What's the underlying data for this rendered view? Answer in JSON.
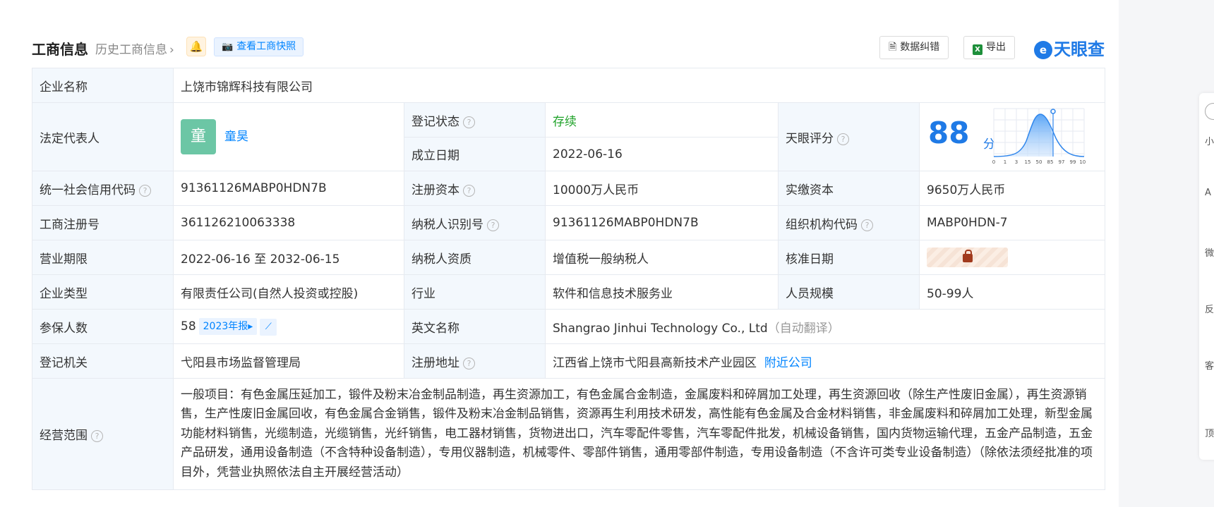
{
  "header": {
    "title": "工商信息",
    "history_link": "历史工商信息",
    "snapshot_btn": "查看工商快照",
    "correction_btn": "数据纠错",
    "export_btn": "导出",
    "logo_text": "天眼查"
  },
  "company": {
    "name_label": "企业名称",
    "name": "上饶市锦辉科技有限公司",
    "legal_label": "法定代表人",
    "legal_avatar": "童",
    "legal_name": "童昊",
    "reg_status_label": "登记状态",
    "reg_status": "存续",
    "found_date_label": "成立日期",
    "found_date": "2022-06-16",
    "score_label": "天眼评分",
    "score_value": "88",
    "score_unit": "分",
    "score_ticks": [
      "0",
      "1",
      "3",
      "15",
      "50",
      "85",
      "97",
      "99",
      "100"
    ],
    "credit_code_label": "统一社会信用代码",
    "credit_code": "91361126MABP0HDN7B",
    "reg_capital_label": "注册资本",
    "reg_capital": "10000万人民币",
    "paid_capital_label": "实缴资本",
    "paid_capital": "9650万人民币",
    "biz_reg_no_label": "工商注册号",
    "biz_reg_no": "361126210063338",
    "taxpayer_id_label": "纳税人识别号",
    "taxpayer_id": "91361126MABP0HDN7B",
    "org_code_label": "组织机构代码",
    "org_code": "MABP0HDN-7",
    "term_label": "营业期限",
    "term": "2022-06-16 至 2032-06-15",
    "tax_qual_label": "纳税人资质",
    "tax_qual": "增值税一般纳税人",
    "approve_date_label": "核准日期",
    "type_label": "企业类型",
    "type": "有限责任公司(自然人投资或控股)",
    "industry_label": "行业",
    "industry": "软件和信息技术服务业",
    "staff_label": "人员规模",
    "staff": "50-99人",
    "insured_label": "参保人数",
    "insured": "58",
    "insured_report": "2023年报",
    "en_name_label": "英文名称",
    "en_name": "Shangrao Jinhui Technology Co., Ltd",
    "en_name_note": "（自动翻译）",
    "authority_label": "登记机关",
    "authority": "弋阳县市场监督管理局",
    "address_label": "注册地址",
    "address": "江西省上饶市弋阳县高新技术产业园区",
    "nearby_link": "附近公司",
    "scope_label": "经营范围",
    "scope": "一般项目：有色金属压延加工，锻件及粉末冶金制品制造，再生资源加工，有色金属合金制造，金属废料和碎屑加工处理，再生资源回收（除生产性废旧金属），再生资源销售，生产性废旧金属回收，有色金属合金销售，锻件及粉末冶金制品销售，资源再生利用技术研发，高性能有色金属及合金材料销售，非金属废料和碎屑加工处理，新型金属功能材料销售，光缆制造，光缆销售，光纤销售，电工器材销售，货物进出口，汽车零配件零售，汽车零配件批发，机械设备销售，国内货物运输代理，五金产品制造，五金产品研发，通用设备制造（不含特种设备制造），专用仪器制造，机械零件、零部件销售，通用零部件制造，专用设备制造（不含许可类专业设备制造）（除依法须经批准的项目外，凭营业执照依法自主开展经营活动）"
  },
  "sidebar": {
    "items": [
      "小",
      "A",
      "微",
      "反",
      "客服",
      "顶"
    ]
  },
  "colors": {
    "accent": "#0084ff",
    "status_green": "#21a32b",
    "label_bg": "#f3f8fd"
  }
}
